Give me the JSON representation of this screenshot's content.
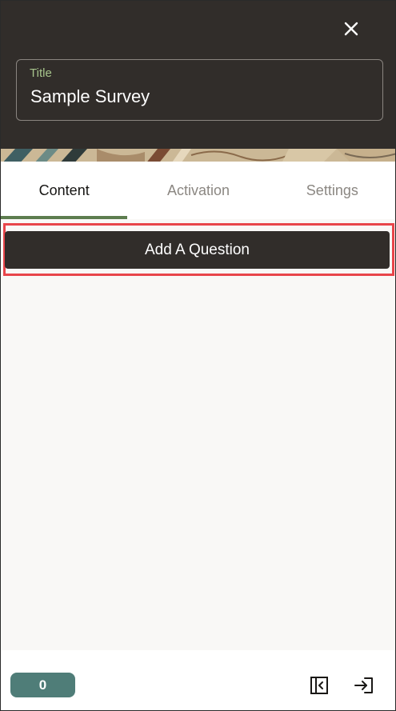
{
  "header": {
    "close_icon": "close-icon",
    "title_field": {
      "label": "Title",
      "value": "Sample Survey"
    }
  },
  "tabs": [
    {
      "label": "Content",
      "selected": true
    },
    {
      "label": "Activation",
      "selected": false
    },
    {
      "label": "Settings",
      "selected": false
    }
  ],
  "content": {
    "add_question_label": "Add A Question"
  },
  "footer": {
    "count": "0",
    "icons": [
      "collapse-panel-icon",
      "exit-icon"
    ]
  },
  "colors": {
    "header_bg": "#312d2a",
    "title_label": "#a7c48c",
    "tab_indicator": "#5d7d4f",
    "highlight_border": "#e8454a",
    "count_badge": "#4f7d78",
    "panel_bg": "#f9f8f6"
  }
}
